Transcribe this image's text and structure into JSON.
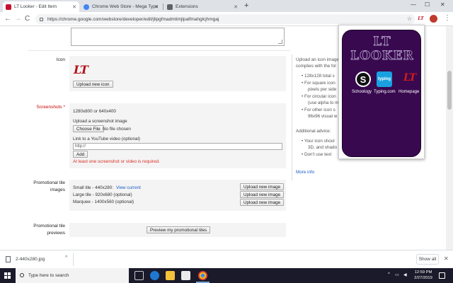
{
  "browser": {
    "tabs": [
      {
        "label": "LT Looker - Edit Item",
        "color": "#c8102e"
      },
      {
        "label": "Chrome Web Store - Mega Type",
        "color": "#4285f4"
      },
      {
        "label": "Extensions",
        "color": "#5f6368"
      }
    ],
    "new_tab": "+",
    "window_controls": {
      "minimize": "—",
      "maximize": "☐",
      "close": "✕"
    },
    "nav": {
      "back": "←",
      "forward": "→",
      "reload": "C"
    },
    "url": "https://chrome.google.com/webstore/developer/edit/jlipgfmadmlimjlpalfmahglcjhmgaj",
    "extension_badge": "LT",
    "menu": "⋮"
  },
  "form": {
    "icon_label": "Icon",
    "icon_logo": "LT",
    "upload_icon_button": "Upload new icon",
    "screenshots_label": "Screenshots *",
    "screenshot_size": "1280x800 or 640x400",
    "upload_screenshot_label": "Upload a screenshot image",
    "choose_file_button": "Choose File",
    "no_file_text": "No file chosen",
    "youtube_label": "Link to a YouTube video (optional)",
    "youtube_value": "http://",
    "add_button": "Add",
    "error_text": "At least one screenshot or video is required.",
    "promo_label_1": "Promotional tile",
    "promo_label_2": "images",
    "small_tile": "Small tile - 440x280:",
    "view_current": "View current",
    "large_tile": "Large tile - 920x680 (optional)",
    "marquee": "Marquee - 1400x560 (optional)",
    "upload_new_image": "Upload new image",
    "preview_label_1": "Promotional tile",
    "preview_label_2": "previews",
    "preview_button": "Preview my promotional tiles"
  },
  "help": {
    "line1": "Upload an icon image",
    "line2": "complies with the fol",
    "b1": "128x128 total s",
    "b2": "For square icon",
    "b3": "pixels per side",
    "b4": "For circular icon",
    "b5": "(use alpha to m",
    "b6": "For other icon s",
    "b7": "96x96 visual w",
    "advice": "Additional advice:",
    "a1": "Your icon shoul",
    "a2": "3D, and shado",
    "a3": "Don't use text",
    "more_info": "More info"
  },
  "popup": {
    "title": "LT LOOKER",
    "links": [
      {
        "label": "Schoology",
        "glyph": "S"
      },
      {
        "label": "Typing.com",
        "glyph": "typing"
      },
      {
        "label": "Homepage",
        "glyph": "LT"
      }
    ]
  },
  "downloads": {
    "file": "2-440x280.jpg",
    "caret": "^",
    "show_all": "Show all",
    "close": "✕"
  },
  "taskbar": {
    "search_placeholder": "Type here to search",
    "time": "12:59 PM",
    "date": "2/27/2019"
  }
}
